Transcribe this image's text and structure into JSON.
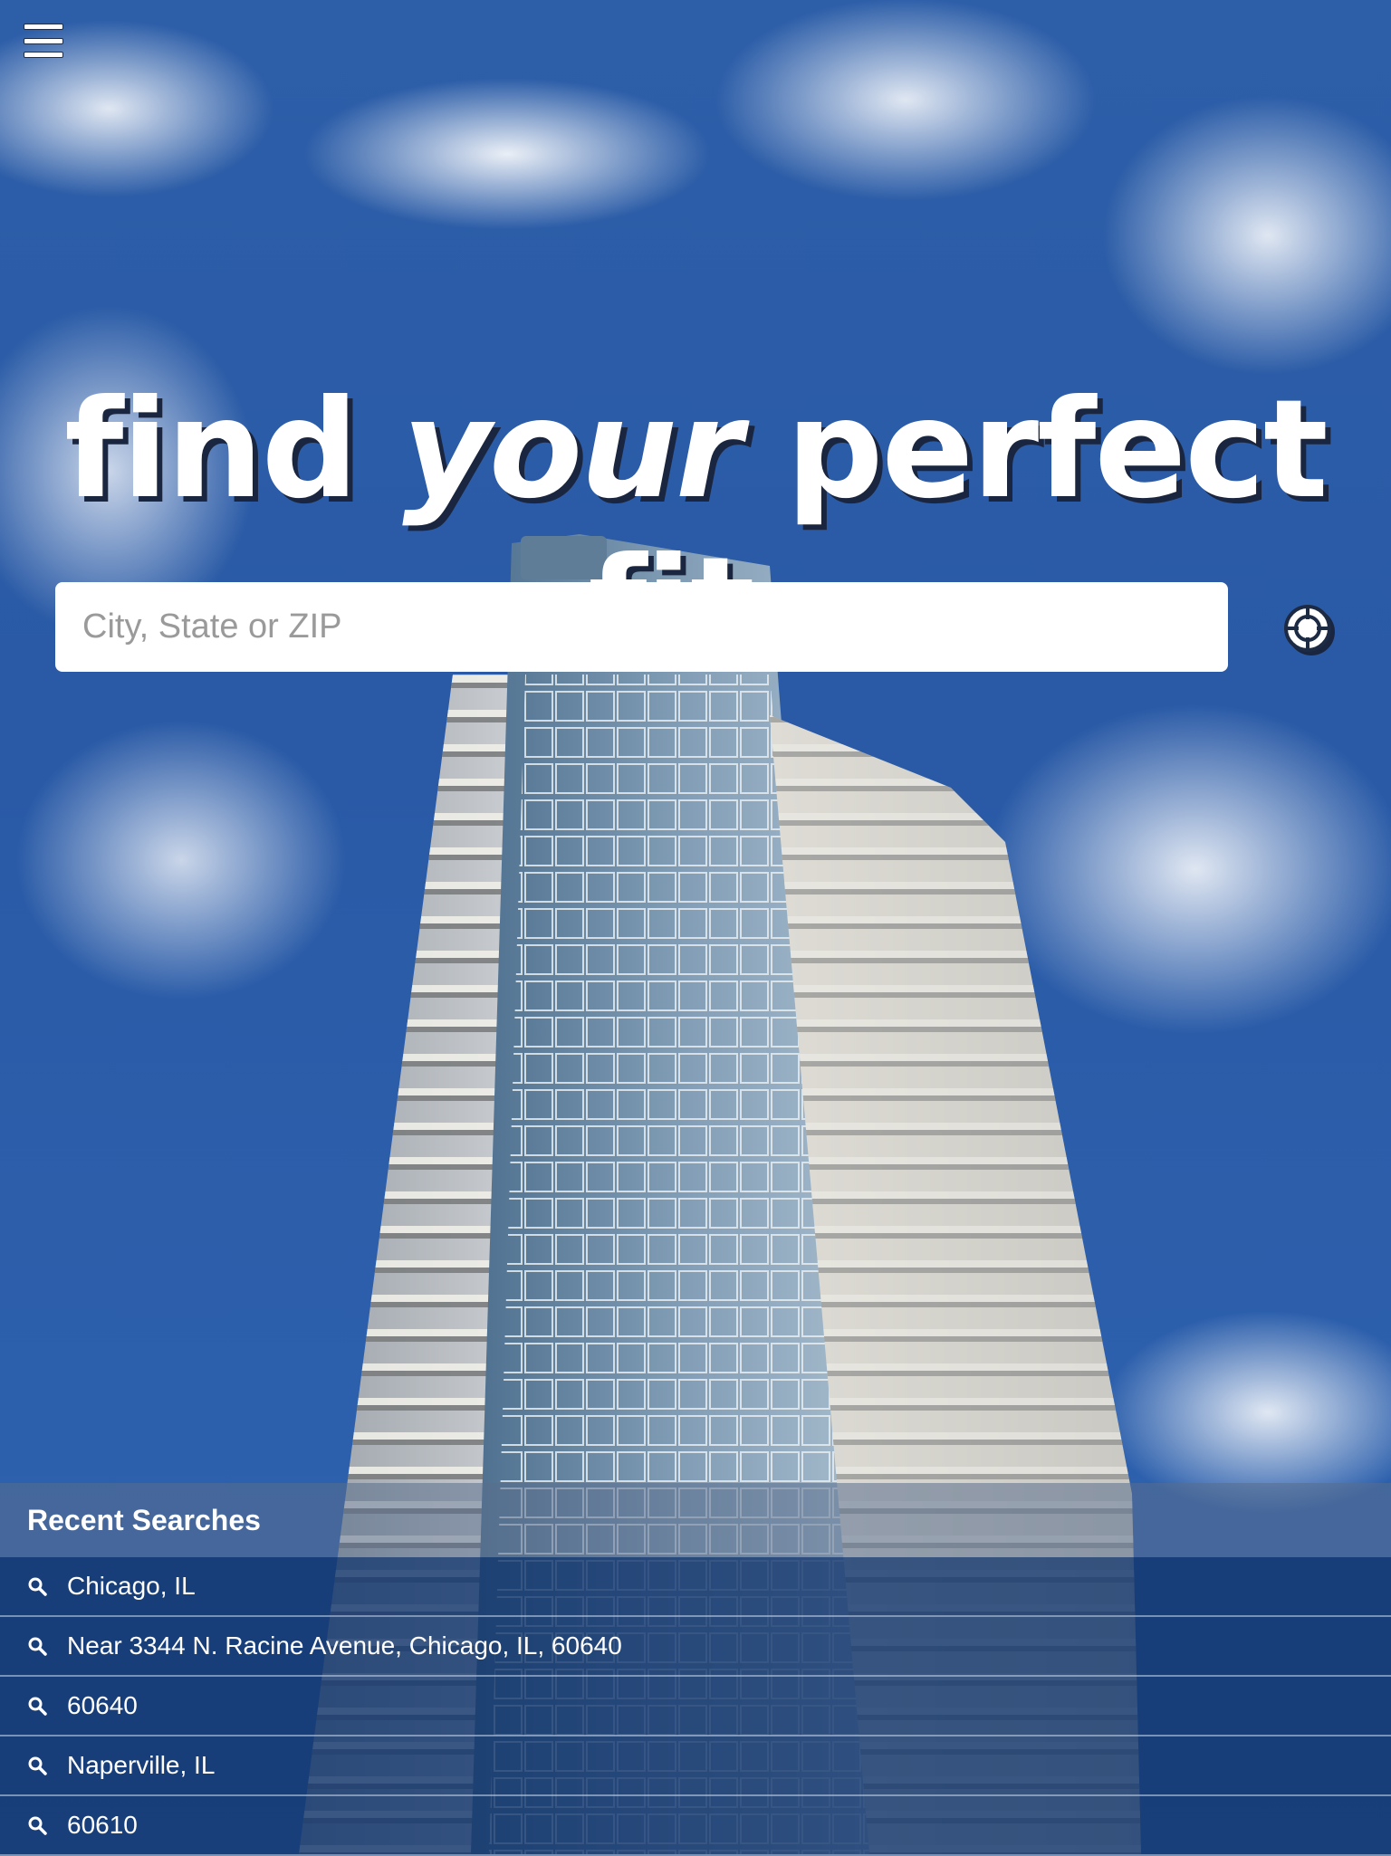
{
  "header": {
    "menu_icon": "hamburger-menu-icon"
  },
  "hero": {
    "headline_part1": "find ",
    "headline_emphasis": "your",
    "headline_part2": " perfect fit."
  },
  "search": {
    "placeholder": "City, State or ZIP",
    "value": "",
    "locate_icon": "crosshair-location-icon"
  },
  "recent_searches": {
    "title": "Recent Searches",
    "item_icon": "search-icon",
    "items": [
      {
        "label": "Chicago, IL"
      },
      {
        "label": "Near 3344 N. Racine Avenue, Chicago, IL, 60640"
      },
      {
        "label": "60640"
      },
      {
        "label": "Naperville, IL"
      },
      {
        "label": "60610"
      }
    ]
  },
  "colors": {
    "sky": "#2d5ea8",
    "recent_list_bg": "#14376e",
    "headline_shadow": "#1a2640"
  }
}
